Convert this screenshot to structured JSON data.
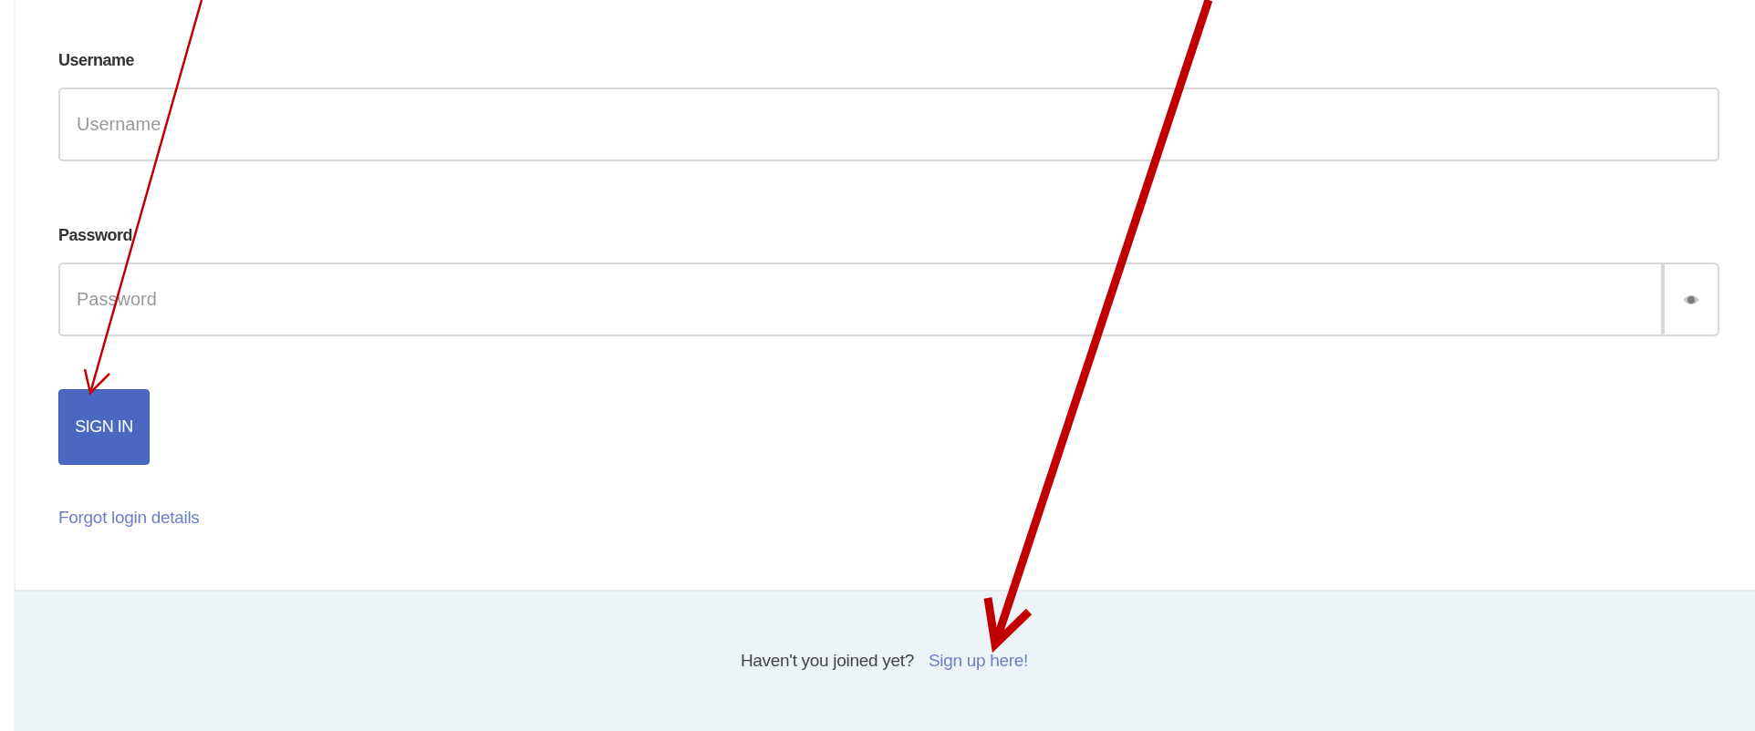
{
  "form": {
    "fields": [
      {
        "label": "Username",
        "placeholder": "Username",
        "kind": "text"
      },
      {
        "label": "Password",
        "placeholder": "Password",
        "kind": "password"
      }
    ],
    "submit": "SIGN IN",
    "forgot_link": "Forgot login details"
  },
  "footer": {
    "prompt": "Haven't you joined yet?",
    "link": "Sign up here!"
  },
  "annotation_arrows": [
    {
      "kind": "thin"
    },
    {
      "kind": "thick"
    }
  ]
}
